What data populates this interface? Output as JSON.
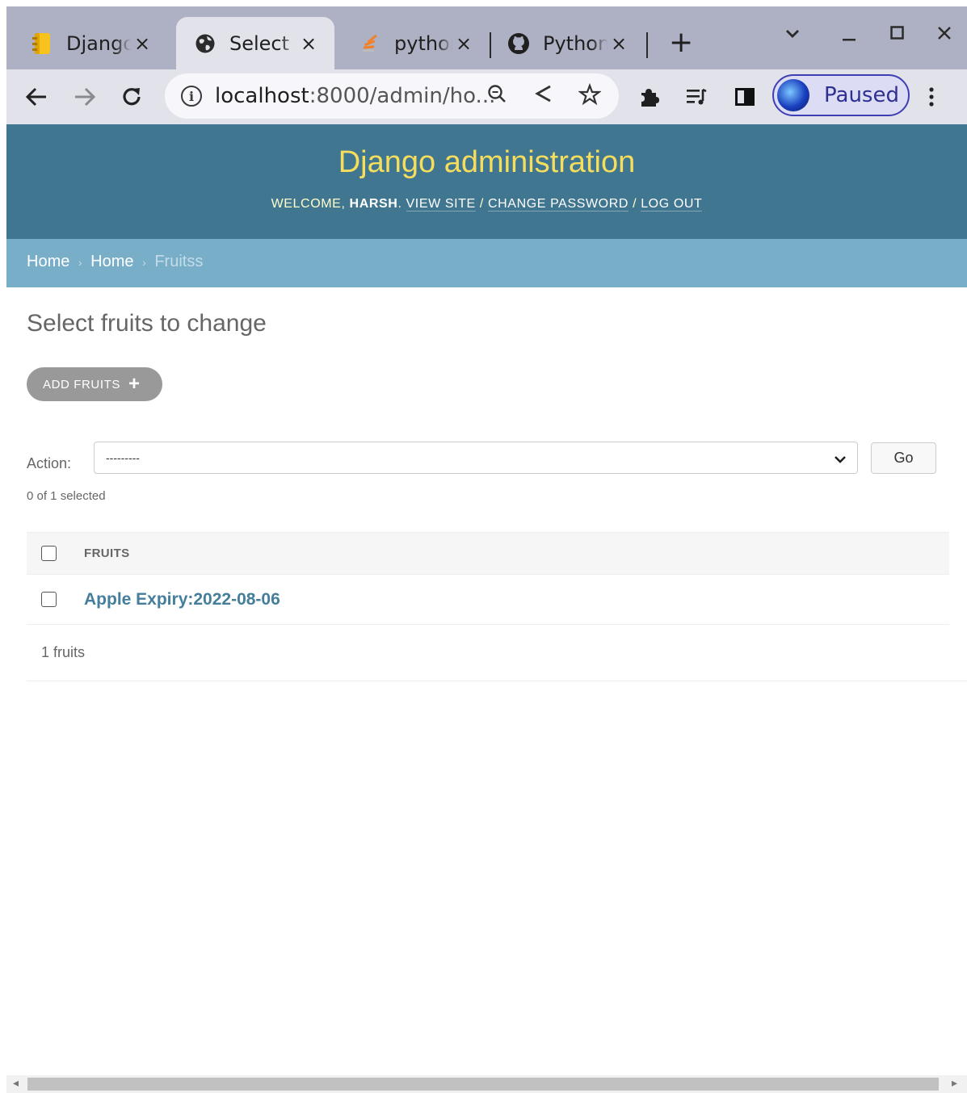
{
  "browser": {
    "tabs": [
      {
        "title": "Django",
        "close": "×"
      },
      {
        "title": "Select",
        "close": "×"
      },
      {
        "title": "python",
        "close": "×"
      },
      {
        "title": "Python",
        "close": "×"
      }
    ],
    "new_tab": "+",
    "url_host": "localhost",
    "url_rest": ":8000/admin/ho...",
    "profile_status": "Paused"
  },
  "django": {
    "site_title": "Django administration",
    "welcome": "WELCOME,",
    "username": "HARSH",
    "view_site": "VIEW SITE",
    "change_password": "CHANGE PASSWORD",
    "log_out": "LOG OUT",
    "sep": "/"
  },
  "breadcrumbs": {
    "home1": "Home",
    "home2": "Home",
    "current": "Fruitss",
    "sep": "›"
  },
  "page": {
    "title": "Select fruits to change",
    "add_button": "ADD FRUITS",
    "action_label": "Action:",
    "action_value": "---------",
    "go_button": "Go",
    "selected_count": "0 of 1 selected",
    "column_header": "FRUITS",
    "rows": [
      {
        "label": "Apple Expiry:2022-08-06"
      }
    ],
    "paginator": "1 fruits"
  },
  "colors": {
    "header_bg": "#417690",
    "branding": "#f5dd5d",
    "breadcrumbs_bg": "#79aec8",
    "link": "#447e9b"
  }
}
